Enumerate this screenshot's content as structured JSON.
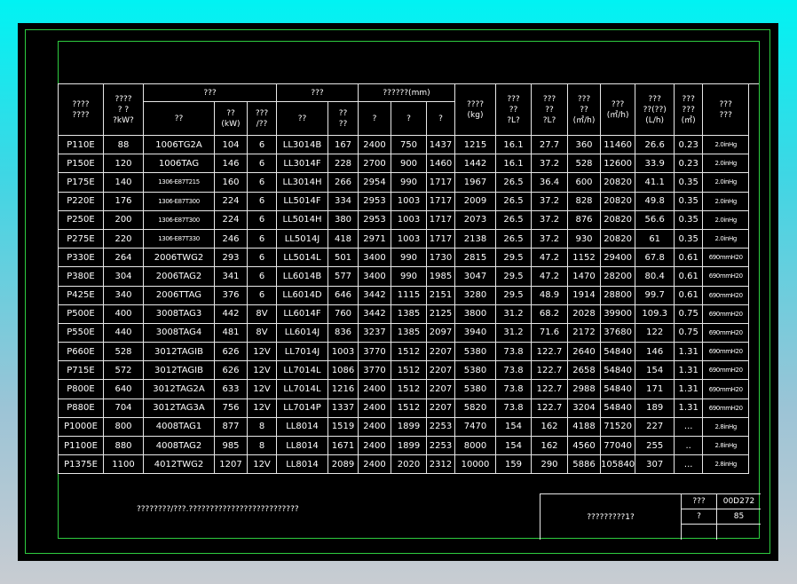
{
  "header": {
    "model": "????\n????",
    "power": "????\n?  ?\n?kW?",
    "engine_group": "???",
    "engine_model": "??",
    "engine_power": "??\n(kW)",
    "engine_cyl": "???\n/??",
    "alt_group": "???",
    "alt_model": "??",
    "alt_power": "??\n??",
    "dim_group": "??????(mm)",
    "dim_l": "?",
    "dim_w": "?",
    "dim_h": "?",
    "weight": "????\n(kg)",
    "fuel1": "???\n??\n?L?",
    "fuel2": "???\n??\n?L?",
    "air1": "???\n??\n(㎥/h)",
    "air2": "???\n(㎥/h)",
    "oil": "???\n??(??)\n(L/h)",
    "vol": "???\n???\n(㎥)",
    "back": "???\n???"
  },
  "rows": [
    [
      "P110E",
      "88",
      "1006TG2A",
      "104",
      "6",
      "LL3014B",
      "167",
      "2400",
      "750",
      "1437",
      "1215",
      "16.1",
      "27.7",
      "360",
      "11460",
      "26.6",
      "0.23",
      "2.0inHg"
    ],
    [
      "P150E",
      "120",
      "1006TAG",
      "146",
      "6",
      "LL3014F",
      "228",
      "2700",
      "900",
      "1460",
      "1442",
      "16.1",
      "37.2",
      "528",
      "12600",
      "33.9",
      "0.23",
      "2.0inHg"
    ],
    [
      "P175E",
      "140",
      "1306-E87T215",
      "160",
      "6",
      "LL3014H",
      "266",
      "2954",
      "990",
      "1717",
      "1967",
      "26.5",
      "36.4",
      "600",
      "20820",
      "41.1",
      "0.35",
      "2.0inHg"
    ],
    [
      "P220E",
      "176",
      "1306-E87T300",
      "224",
      "6",
      "LL5014F",
      "334",
      "2953",
      "1003",
      "1717",
      "2009",
      "26.5",
      "37.2",
      "828",
      "20820",
      "49.8",
      "0.35",
      "2.0inHg"
    ],
    [
      "P250E",
      "200",
      "1306-E87T300",
      "224",
      "6",
      "LL5014H",
      "380",
      "2953",
      "1003",
      "1717",
      "2073",
      "26.5",
      "37.2",
      "876",
      "20820",
      "56.6",
      "0.35",
      "2.0inHg"
    ],
    [
      "P275E",
      "220",
      "1306-E87T330",
      "246",
      "6",
      "LL5014J",
      "418",
      "2971",
      "1003",
      "1717",
      "2138",
      "26.5",
      "37.2",
      "930",
      "20820",
      "61",
      "0.35",
      "2.0inHg"
    ],
    [
      "P330E",
      "264",
      "2006TWG2",
      "293",
      "6",
      "LL5014L",
      "501",
      "3400",
      "990",
      "1730",
      "2815",
      "29.5",
      "47.2",
      "1152",
      "29400",
      "67.8",
      "0.61",
      "690mmH20"
    ],
    [
      "P380E",
      "304",
      "2006TAG2",
      "341",
      "6",
      "LL6014B",
      "577",
      "3400",
      "990",
      "1985",
      "3047",
      "29.5",
      "47.2",
      "1470",
      "28200",
      "80.4",
      "0.61",
      "690mmH20"
    ],
    [
      "P425E",
      "340",
      "2006TTAG",
      "376",
      "6",
      "LL6014D",
      "646",
      "3442",
      "1115",
      "2151",
      "3280",
      "29.5",
      "48.9",
      "1914",
      "28800",
      "99.7",
      "0.61",
      "690mmH20"
    ],
    [
      "P500E",
      "400",
      "3008TAG3",
      "442",
      "8V",
      "LL6014F",
      "760",
      "3442",
      "1385",
      "2125",
      "3800",
      "31.2",
      "68.2",
      "2028",
      "39900",
      "109.3",
      "0.75",
      "690mmH20"
    ],
    [
      "P550E",
      "440",
      "3008TAG4",
      "481",
      "8V",
      "LL6014J",
      "836",
      "3237",
      "1385",
      "2097",
      "3940",
      "31.2",
      "71.6",
      "2172",
      "37680",
      "122",
      "0.75",
      "690mmH20"
    ],
    [
      "P660E",
      "528",
      "3012TAGIB",
      "626",
      "12V",
      "LL7014J",
      "1003",
      "3770",
      "1512",
      "2207",
      "5380",
      "73.8",
      "122.7",
      "2640",
      "54840",
      "146",
      "1.31",
      "690mmH20"
    ],
    [
      "P715E",
      "572",
      "3012TAGIB",
      "626",
      "12V",
      "LL7014L",
      "1086",
      "3770",
      "1512",
      "2207",
      "5380",
      "73.8",
      "122.7",
      "2658",
      "54840",
      "154",
      "1.31",
      "690mmH20"
    ],
    [
      "P800E",
      "640",
      "3012TAG2A",
      "633",
      "12V",
      "LL7014L",
      "1216",
      "2400",
      "1512",
      "2207",
      "5380",
      "73.8",
      "122.7",
      "2988",
      "54840",
      "171",
      "1.31",
      "690mmH20"
    ],
    [
      "P880E",
      "704",
      "3012TAG3A",
      "756",
      "12V",
      "LL7014P",
      "1337",
      "2400",
      "1512",
      "2207",
      "5820",
      "73.8",
      "122.7",
      "3204",
      "54840",
      "189",
      "1.31",
      "690mmH20"
    ],
    [
      "P1000E",
      "800",
      "4008TAG1",
      "877",
      "8",
      "LL8014",
      "1519",
      "2400",
      "1899",
      "2253",
      "7470",
      "154",
      "162",
      "4188",
      "71520",
      "227",
      "...",
      "2.8inHg"
    ],
    [
      "P1100E",
      "880",
      "4008TAG2",
      "985",
      "8",
      "LL8014",
      "1671",
      "2400",
      "1899",
      "2253",
      "8000",
      "154",
      "162",
      "4560",
      "77040",
      "255",
      "..",
      "2.8inHg"
    ],
    [
      "P1375E",
      "1100",
      "4012TWG2",
      "1207",
      "12V",
      "LL8014",
      "2089",
      "2400",
      "2020",
      "2312",
      "10000",
      "159",
      "290",
      "5886",
      "105840",
      "307",
      "...",
      "2.8inHg"
    ]
  ],
  "note": "????????/???.??????????????????????????",
  "title_block": {
    "name": "?????????1?",
    "label1": "???",
    "value1": "00D272",
    "label2": "?",
    "value2": "85"
  },
  "colors": {
    "line": "#2ecc40",
    "grid": "#e8e8e8",
    "background": "#000000"
  }
}
